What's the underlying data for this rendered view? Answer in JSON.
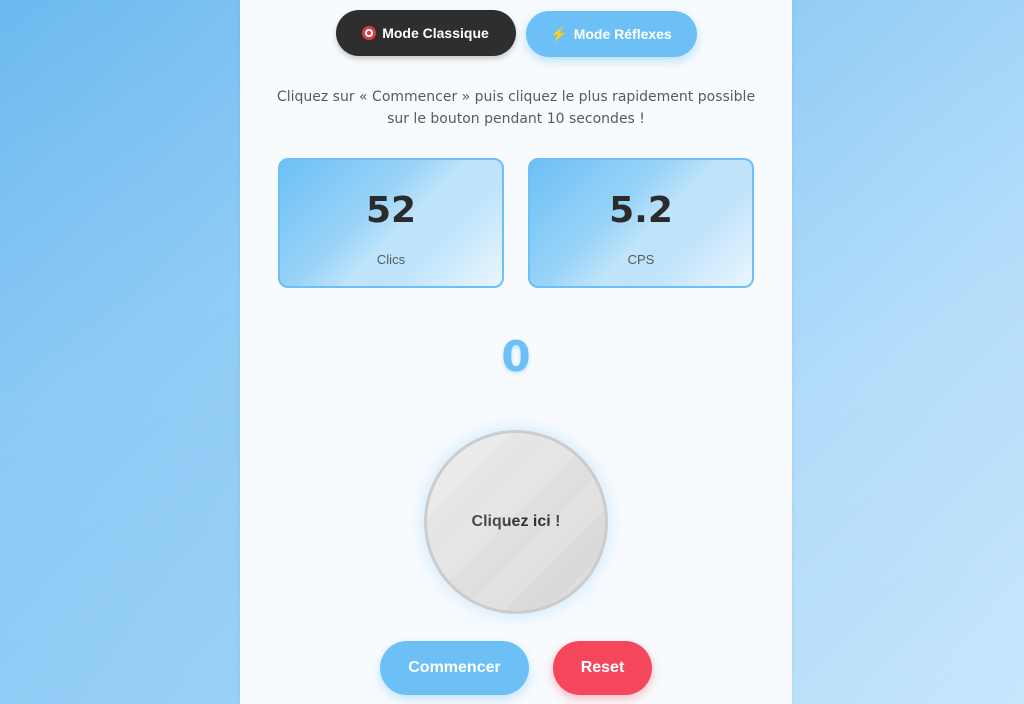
{
  "modes": {
    "classic": {
      "label": "Mode Classique",
      "icon": "target-icon"
    },
    "reflex": {
      "label": "Mode Réflexes",
      "icon": "lightning-icon"
    }
  },
  "instructions": "Cliquez sur « Commencer » puis cliquez le plus rapidement possible sur le bouton pendant 10 secondes !",
  "stats": {
    "clicks": {
      "value": "52",
      "label": "Clics"
    },
    "cps": {
      "value": "5.2",
      "label": "CPS"
    }
  },
  "timer": "0",
  "click_button_label": "Cliquez ici !",
  "actions": {
    "start_label": "Commencer",
    "reset_label": "Reset"
  },
  "colors": {
    "accent": "#6cc0f5",
    "dark": "#2e2e2e",
    "danger": "#f5475b"
  }
}
